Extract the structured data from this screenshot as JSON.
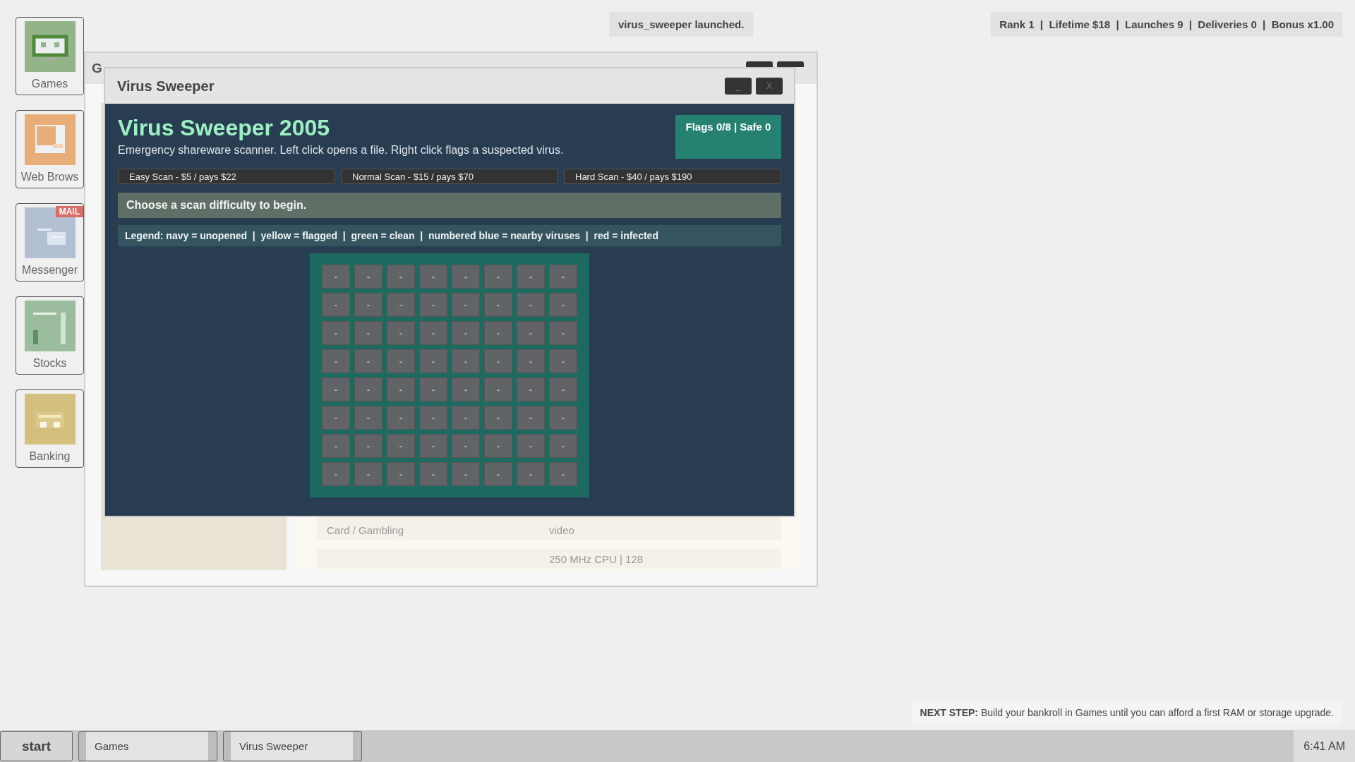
{
  "desktop_icons": [
    {
      "kind": "games",
      "label": "Games"
    },
    {
      "kind": "browser",
      "label": "Web Brows"
    },
    {
      "kind": "messenger",
      "label": "Messenger",
      "badge": "MAIL"
    },
    {
      "kind": "stocks",
      "label": "Stocks"
    },
    {
      "kind": "banking",
      "label": "Banking"
    }
  ],
  "notification": "virus_sweeper launched.",
  "stats": "Rank 1  |  Lifetime $18  |  Launches 9  |  Deliveries 0  |  Bonus x1.00",
  "background_window": {
    "title": "G",
    "category": "Card / Gambling",
    "detail": "video",
    "next_detail": "250 MHz CPU | 128"
  },
  "window": {
    "title": "Virus Sweeper",
    "minimize": "_",
    "close": "X",
    "heading": "Virus Sweeper 2005",
    "description": "Emergency shareware scanner. Left click opens a file. Right click flags a suspected virus.",
    "counter": "Flags 0/8 | Safe 0",
    "difficulties": [
      "Easy Scan - $5 / pays $22",
      "Normal Scan - $15 / pays $70",
      "Hard Scan - $40 / pays $190"
    ],
    "status": "Choose a scan difficulty to begin.",
    "legend": "Legend: navy = unopened  |  yellow = flagged  |  green = clean  |  numbered blue = nearby viruses  |  red = infected",
    "board": [
      [
        "-",
        "-",
        "-",
        "-",
        "-",
        "-",
        "-",
        "-"
      ],
      [
        "-",
        "-",
        "-",
        "-",
        "-",
        "-",
        "-",
        "-"
      ],
      [
        "-",
        "-",
        "-",
        "-",
        "-",
        "-",
        "-",
        "-"
      ],
      [
        "-",
        "-",
        "-",
        "-",
        "-",
        "-",
        "-",
        "-"
      ],
      [
        "-",
        "-",
        "-",
        "-",
        "-",
        "-",
        "-",
        "-"
      ],
      [
        "-",
        "-",
        "-",
        "-",
        "-",
        "-",
        "-",
        "-"
      ],
      [
        "-",
        "-",
        "-",
        "-",
        "-",
        "-",
        "-",
        "-"
      ],
      [
        "-",
        "-",
        "-",
        "-",
        "-",
        "-",
        "-",
        "-"
      ]
    ]
  },
  "next_step": "**NEXT STEP:** Build your bankroll in Games until you can afford a first RAM or storage upgrade.",
  "taskbar": {
    "start": "start",
    "items": [
      "Games",
      "Virus Sweeper"
    ],
    "clock": "6:41 AM"
  }
}
